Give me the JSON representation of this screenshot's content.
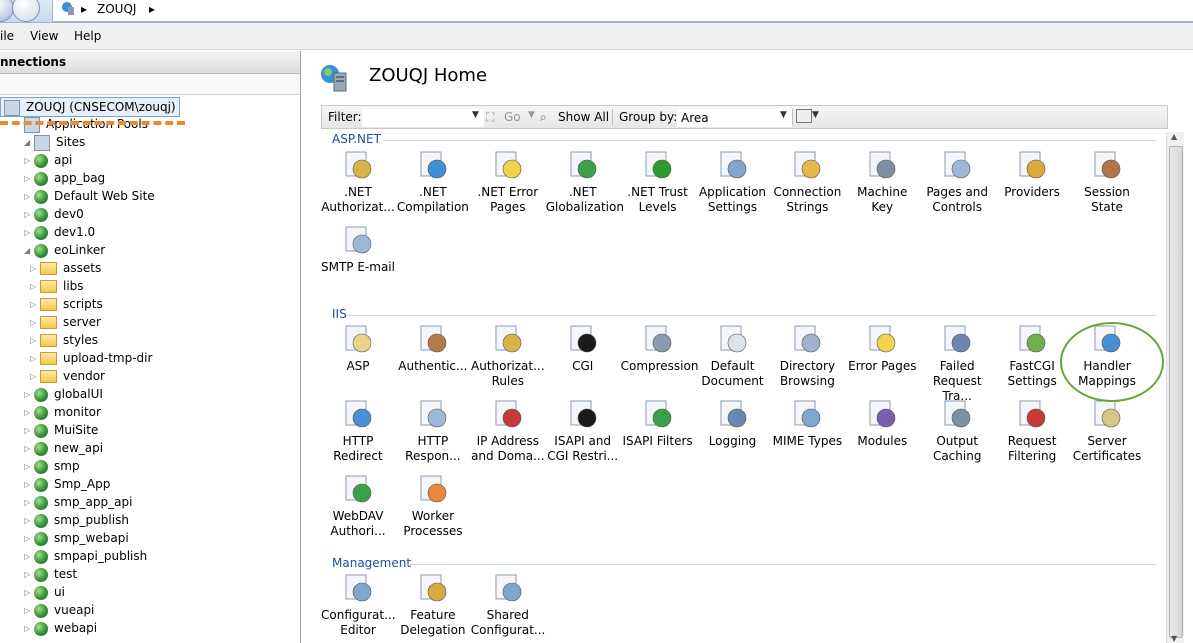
{
  "address": {
    "crumbs": [
      "ZOUQJ"
    ]
  },
  "menu": {
    "items": [
      "ile",
      "View",
      "Help"
    ]
  },
  "left": {
    "header": "nnections",
    "tree": [
      {
        "label": "ZOUQJ (CNSECOM\\zouqj)",
        "kind": "server",
        "level": 0,
        "selected": true
      },
      {
        "label": "Application Pools",
        "kind": "pool",
        "level": 1
      },
      {
        "label": "Sites",
        "kind": "sites",
        "level": 1
      },
      {
        "label": "api",
        "kind": "site",
        "level": 2
      },
      {
        "label": "app_bag",
        "kind": "site",
        "level": 2
      },
      {
        "label": "Default Web Site",
        "kind": "site",
        "level": 2
      },
      {
        "label": "dev0",
        "kind": "site",
        "level": 2
      },
      {
        "label": "dev1.0",
        "kind": "site",
        "level": 2
      },
      {
        "label": "eoLinker",
        "kind": "site",
        "level": 2,
        "expanded": true
      },
      {
        "label": "assets",
        "kind": "folder",
        "level": 3
      },
      {
        "label": "libs",
        "kind": "folder",
        "level": 3
      },
      {
        "label": "scripts",
        "kind": "folder",
        "level": 3
      },
      {
        "label": "server",
        "kind": "folder",
        "level": 3
      },
      {
        "label": "styles",
        "kind": "folder",
        "level": 3
      },
      {
        "label": "upload-tmp-dir",
        "kind": "folder",
        "level": 3
      },
      {
        "label": "vendor",
        "kind": "folder",
        "level": 3
      },
      {
        "label": "globalUI",
        "kind": "site",
        "level": 2
      },
      {
        "label": "monitor",
        "kind": "site",
        "level": 2
      },
      {
        "label": "MuiSite",
        "kind": "site",
        "level": 2
      },
      {
        "label": "new_api",
        "kind": "site",
        "level": 2
      },
      {
        "label": "smp",
        "kind": "site",
        "level": 2
      },
      {
        "label": "Smp_App",
        "kind": "site",
        "level": 2
      },
      {
        "label": "smp_app_api",
        "kind": "site",
        "level": 2
      },
      {
        "label": "smp_publish",
        "kind": "site",
        "level": 2
      },
      {
        "label": "smp_webapi",
        "kind": "site",
        "level": 2
      },
      {
        "label": "smpapi_publish",
        "kind": "site",
        "level": 2
      },
      {
        "label": "test",
        "kind": "site",
        "level": 2
      },
      {
        "label": "ui",
        "kind": "site",
        "level": 2
      },
      {
        "label": "vueapi",
        "kind": "site",
        "level": 2
      },
      {
        "label": "webapi",
        "kind": "site",
        "level": 2
      }
    ]
  },
  "main": {
    "title": "ZOUQJ Home",
    "filter": {
      "label": "Filter:",
      "value": "",
      "go": "Go",
      "show_all": "Show All",
      "group_by_label": "Group by:",
      "group_by_value": "Area"
    },
    "groups": [
      {
        "name": "ASP.NET",
        "items": [
          {
            "l1": ".NET",
            "l2": "Authorizat...",
            "icon": "net-authorization-icon",
            "color": "#d9b24a"
          },
          {
            "l1": ".NET",
            "l2": "Compilation",
            "icon": "net-compilation-icon",
            "color": "#3e8fd6"
          },
          {
            "l1": ".NET Error",
            "l2": "Pages",
            "icon": "net-error-pages-icon",
            "color": "#f2d24a"
          },
          {
            "l1": ".NET",
            "l2": "Globalization",
            "icon": "net-globalization-icon",
            "color": "#3aa14a"
          },
          {
            "l1": ".NET Trust",
            "l2": "Levels",
            "icon": "net-trust-levels-icon",
            "color": "#2f9a2f"
          },
          {
            "l1": "Application",
            "l2": "Settings",
            "icon": "application-settings-icon",
            "color": "#7fa6cc"
          },
          {
            "l1": "Connection",
            "l2": "Strings",
            "icon": "connection-strings-icon",
            "color": "#e6b84a"
          },
          {
            "l1": "Machine Key",
            "l2": "",
            "icon": "machine-key-icon",
            "color": "#7d8fa3"
          },
          {
            "l1": "Pages and",
            "l2": "Controls",
            "icon": "pages-controls-icon",
            "color": "#9bb8d6"
          },
          {
            "l1": "Providers",
            "l2": "",
            "icon": "providers-icon",
            "color": "#d9a93e"
          },
          {
            "l1": "Session State",
            "l2": "",
            "icon": "session-state-icon",
            "color": "#b0764a"
          },
          {
            "l1": "SMTP E-mail",
            "l2": "",
            "icon": "smtp-email-icon",
            "color": "#9fb7d6"
          }
        ]
      },
      {
        "name": "IIS",
        "items": [
          {
            "l1": "ASP",
            "l2": "",
            "icon": "asp-icon",
            "color": "#e8d38a"
          },
          {
            "l1": "Authentic...",
            "l2": "",
            "icon": "authentication-icon",
            "color": "#b27a48"
          },
          {
            "l1": "Authorizat...",
            "l2": "Rules",
            "icon": "authorization-rules-icon",
            "color": "#d9b24a"
          },
          {
            "l1": "CGI",
            "l2": "",
            "icon": "cgi-icon",
            "color": "#1a1a1a"
          },
          {
            "l1": "Compression",
            "l2": "",
            "icon": "compression-icon",
            "color": "#8a9bb0"
          },
          {
            "l1": "Default",
            "l2": "Document",
            "icon": "default-document-icon",
            "color": "#dde3ea"
          },
          {
            "l1": "Directory",
            "l2": "Browsing",
            "icon": "directory-browsing-icon",
            "color": "#9fb4cc"
          },
          {
            "l1": "Error Pages",
            "l2": "",
            "icon": "error-pages-icon",
            "color": "#f2d24a"
          },
          {
            "l1": "Failed",
            "l2": "Request Tra...",
            "icon": "failed-request-tracing-icon",
            "color": "#6b86b0"
          },
          {
            "l1": "FastCGI",
            "l2": "Settings",
            "icon": "fastcgi-settings-icon",
            "color": "#6eb04a"
          },
          {
            "l1": "Handler",
            "l2": "Mappings",
            "icon": "handler-mappings-icon",
            "color": "#4a8fd6"
          },
          {
            "l1": "HTTP",
            "l2": "Redirect",
            "icon": "http-redirect-icon",
            "color": "#4a8fd6"
          },
          {
            "l1": "HTTP",
            "l2": "Respon...",
            "icon": "http-response-headers-icon",
            "color": "#9bb8d6"
          },
          {
            "l1": "IP Address",
            "l2": "and Doma...",
            "icon": "ip-domain-restrictions-icon",
            "color": "#c63a3a"
          },
          {
            "l1": "ISAPI and",
            "l2": "CGI Restri...",
            "icon": "isapi-cgi-restrictions-icon",
            "color": "#1a1a1a"
          },
          {
            "l1": "ISAPI Filters",
            "l2": "",
            "icon": "isapi-filters-icon",
            "color": "#3aa14a"
          },
          {
            "l1": "Logging",
            "l2": "",
            "icon": "logging-icon",
            "color": "#6b86b0"
          },
          {
            "l1": "MIME Types",
            "l2": "",
            "icon": "mime-types-icon",
            "color": "#7fa6cc"
          },
          {
            "l1": "Modules",
            "l2": "",
            "icon": "modules-icon",
            "color": "#7a5fb0"
          },
          {
            "l1": "Output",
            "l2": "Caching",
            "icon": "output-caching-icon",
            "color": "#7d8fa3"
          },
          {
            "l1": "Request",
            "l2": "Filtering",
            "icon": "request-filtering-icon",
            "color": "#c63a3a"
          },
          {
            "l1": "Server",
            "l2": "Certificates",
            "icon": "server-certificates-icon",
            "color": "#d9c48a"
          },
          {
            "l1": "WebDAV",
            "l2": "Authori...",
            "icon": "webdav-authoring-icon",
            "color": "#3aa14a"
          },
          {
            "l1": "Worker",
            "l2": "Processes",
            "icon": "worker-processes-icon",
            "color": "#e8893a"
          }
        ]
      },
      {
        "name": "Management",
        "items": [
          {
            "l1": "Configurat...",
            "l2": "Editor",
            "icon": "configuration-editor-icon",
            "color": "#7fa6cc"
          },
          {
            "l1": "Feature",
            "l2": "Delegation",
            "icon": "feature-delegation-icon",
            "color": "#d9a93e"
          },
          {
            "l1": "Shared",
            "l2": "Configurat...",
            "icon": "shared-configuration-icon",
            "color": "#7fa6cc"
          }
        ]
      }
    ]
  }
}
